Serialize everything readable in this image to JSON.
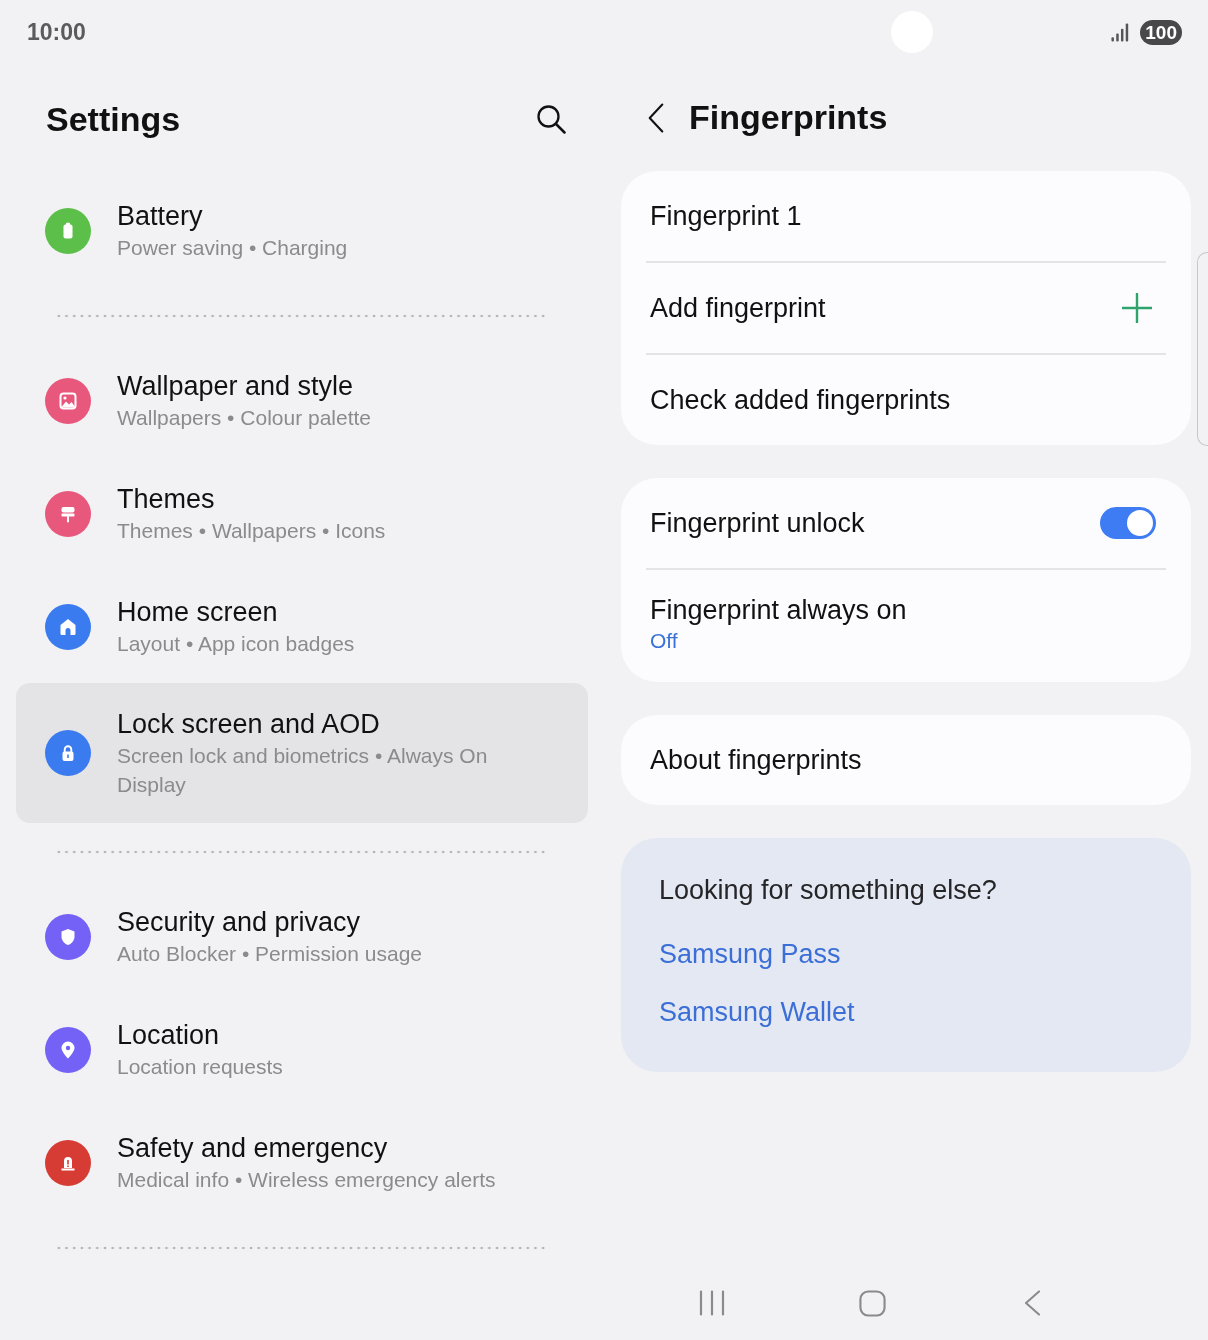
{
  "status_bar": {
    "time": "10:00",
    "battery": "100"
  },
  "settings": {
    "title": "Settings",
    "sections": [
      {
        "items": [
          {
            "title": "Battery",
            "subtitle": "Power saving • Charging",
            "color": "#5cbf4a",
            "selected": false
          }
        ]
      },
      {
        "items": [
          {
            "title": "Wallpaper and style",
            "subtitle": "Wallpapers • Colour palette",
            "color": "#e8587c",
            "selected": false
          },
          {
            "title": "Themes",
            "subtitle": "Themes • Wallpapers • Icons",
            "color": "#e8587c",
            "selected": false
          },
          {
            "title": "Home screen",
            "subtitle": "Layout • App icon badges",
            "color": "#3b7bf0",
            "selected": false
          },
          {
            "title": "Lock screen and AOD",
            "subtitle": "Screen lock and biometrics • Always On Display",
            "color": "#3b7bf0",
            "selected": true
          }
        ]
      },
      {
        "items": [
          {
            "title": "Security and privacy",
            "subtitle": "Auto Blocker • Permission usage",
            "color": "#7462f6",
            "selected": false
          },
          {
            "title": "Location",
            "subtitle": "Location requests",
            "color": "#7462f6",
            "selected": false
          },
          {
            "title": "Safety and emergency",
            "subtitle": "Medical info • Wireless emergency alerts",
            "color": "#d63c34",
            "selected": false
          }
        ]
      }
    ]
  },
  "fingerprints": {
    "title": "Fingerprints",
    "groups": [
      {
        "rows": [
          {
            "kind": "item",
            "label": "Fingerprint 1"
          },
          {
            "kind": "action",
            "label": "Add fingerprint"
          },
          {
            "kind": "item",
            "label": "Check added fingerprints"
          }
        ]
      },
      {
        "rows": [
          {
            "kind": "toggle",
            "label": "Fingerprint unlock",
            "on": true
          },
          {
            "kind": "value",
            "label": "Fingerprint always on",
            "value": "Off"
          }
        ]
      },
      {
        "rows": [
          {
            "kind": "item",
            "label": "About fingerprints"
          }
        ]
      }
    ],
    "suggestions": {
      "heading": "Looking for something else?",
      "links": [
        "Samsung Pass",
        "Samsung Wallet"
      ]
    }
  }
}
